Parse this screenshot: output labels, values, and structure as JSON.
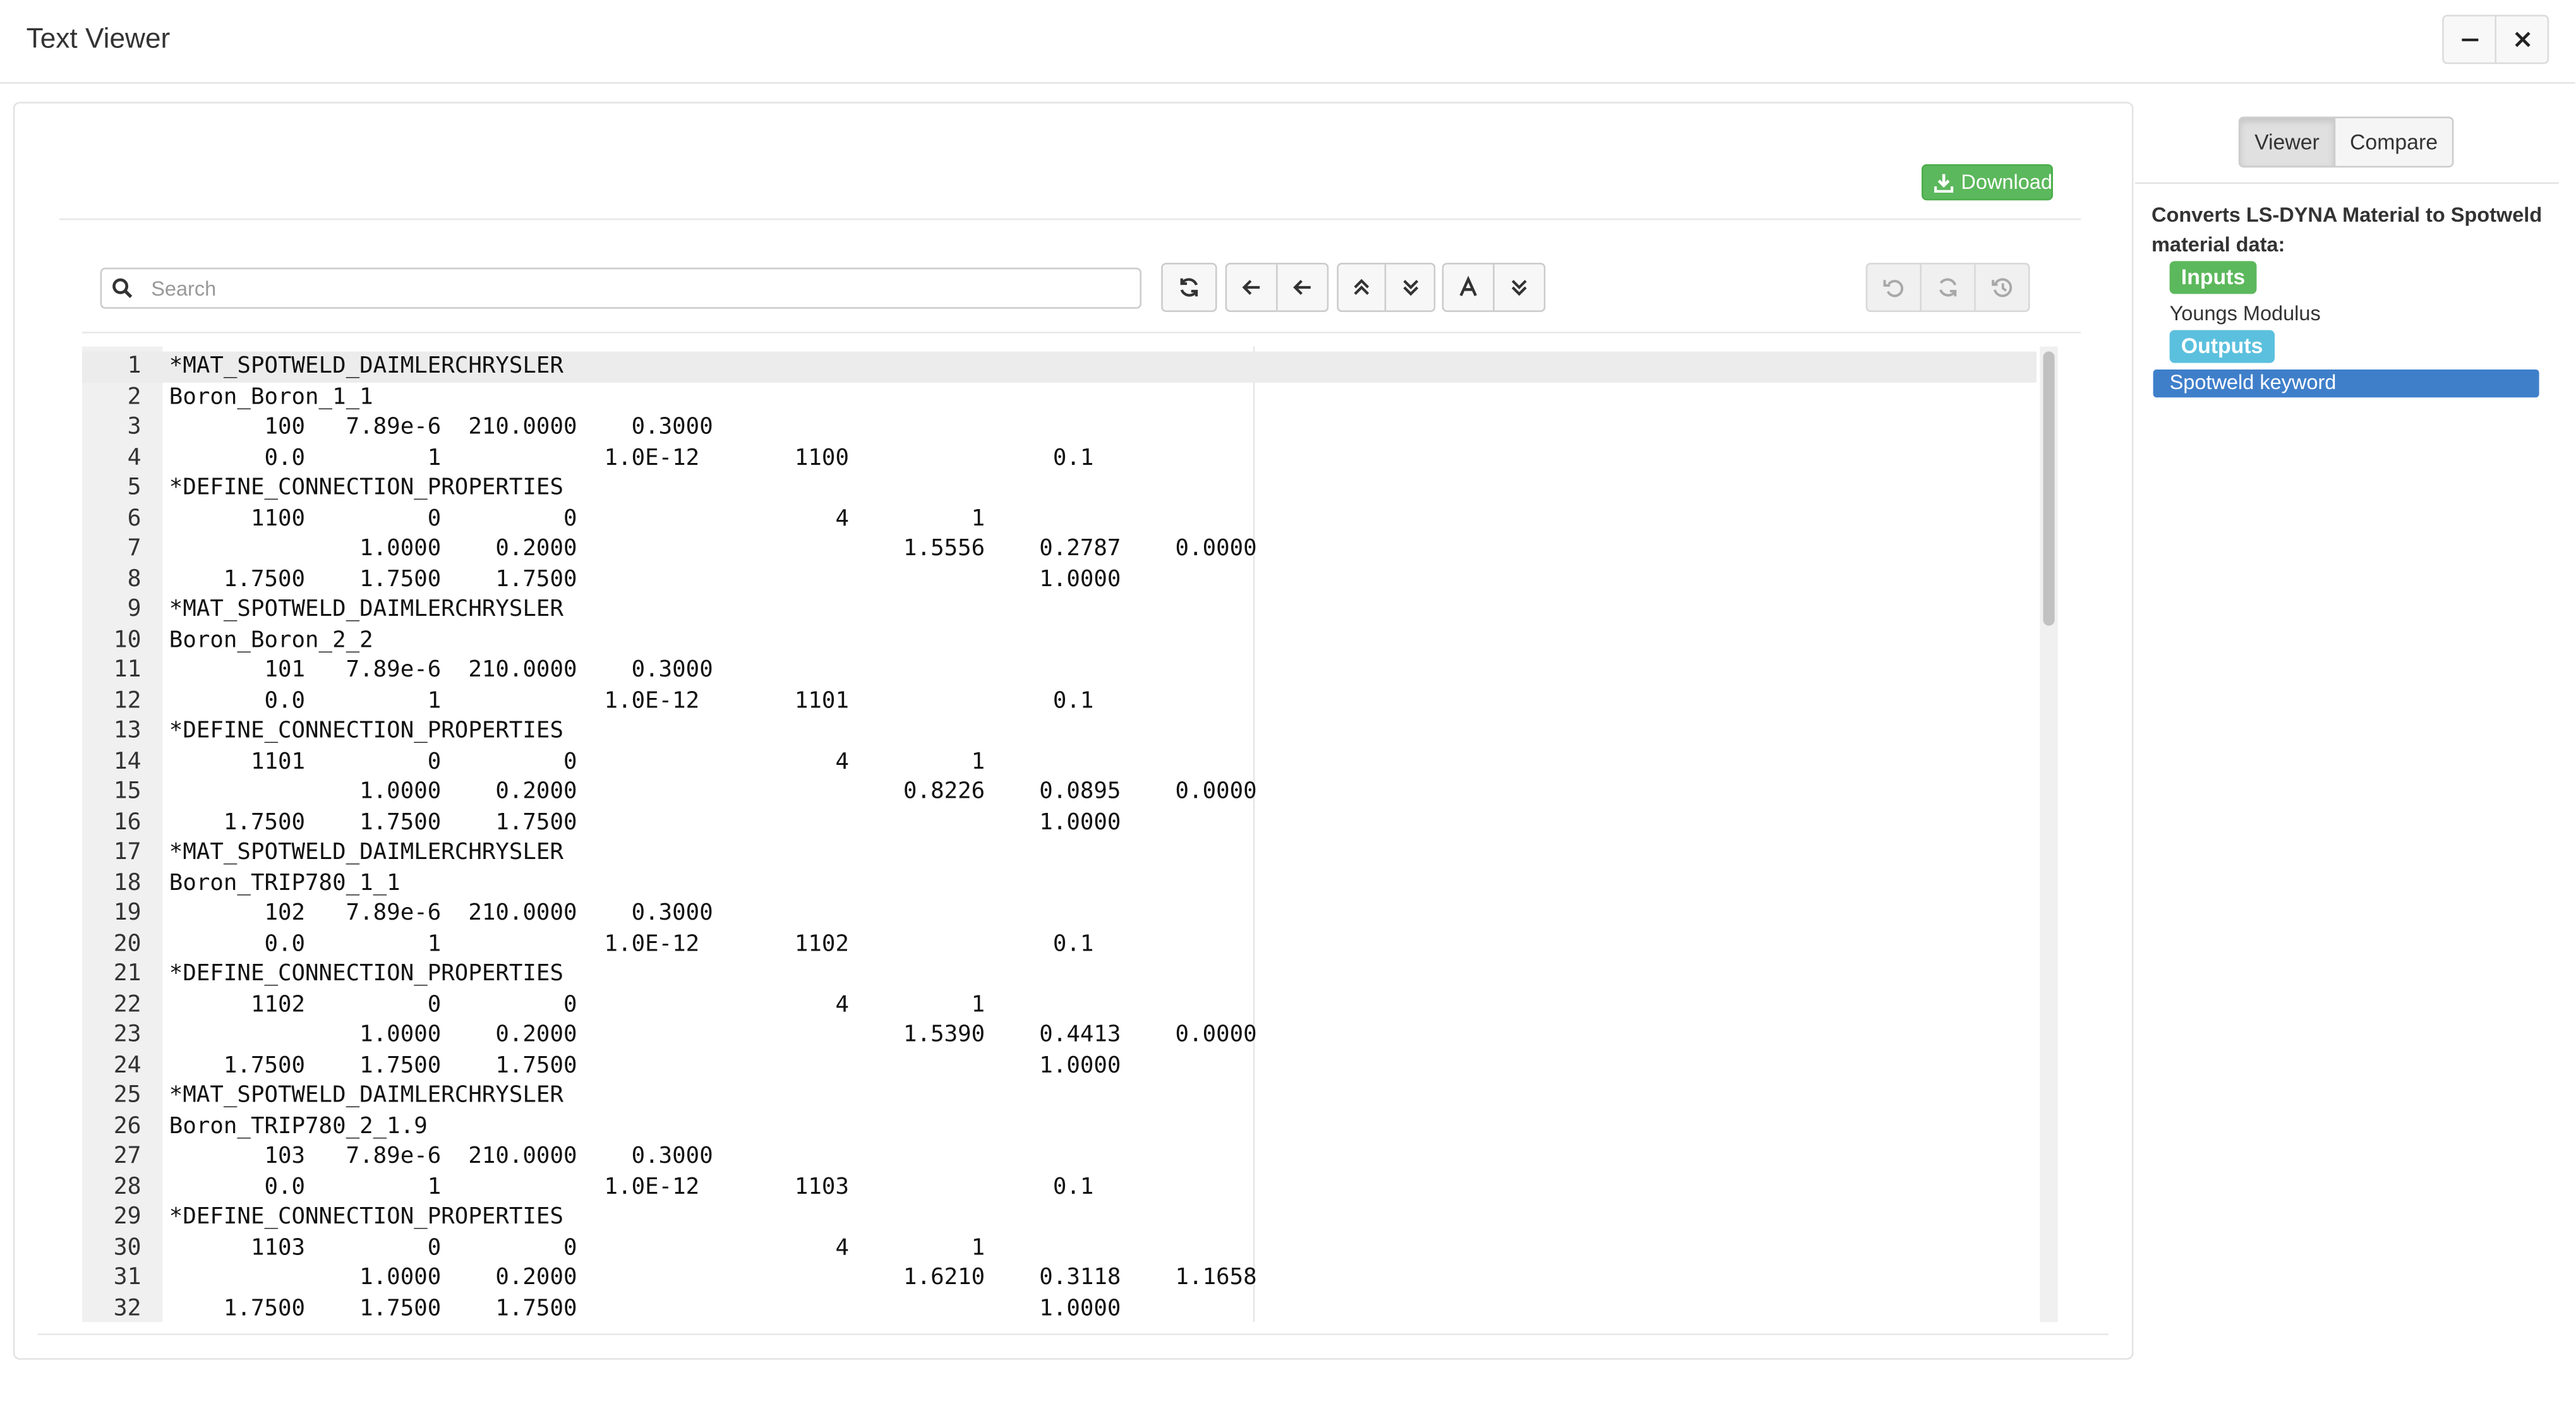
{
  "window": {
    "title": "Text Viewer",
    "minimize_icon": "minus-icon",
    "close_icon": "close-icon"
  },
  "download": {
    "label": "Download",
    "icon": "download-icon",
    "color": "#5cb85c"
  },
  "search": {
    "placeholder": "Search",
    "value": "",
    "icon": "search-icon"
  },
  "toolbar": {
    "icons": [
      "refresh-icon",
      "arrow-left-icon",
      "arrow-left-icon",
      "chevrons-up-icon",
      "chevrons-down-icon",
      "font-icon",
      "chevrons-down-icon",
      "undo-icon",
      "redo-icon",
      "history-icon"
    ]
  },
  "editor": {
    "active_line": 1,
    "lines": [
      "*MAT_SPOTWELD_DAIMLERCHRYSLER",
      "Boron_Boron_1_1",
      "       100   7.89e-6  210.0000    0.3000",
      "       0.0         1            1.0E-12       1100               0.1",
      "*DEFINE_CONNECTION_PROPERTIES",
      "      1100         0         0                   4         1",
      "              1.0000    0.2000                        1.5556    0.2787    0.0000",
      "    1.7500    1.7500    1.7500                                  1.0000",
      "*MAT_SPOTWELD_DAIMLERCHRYSLER",
      "Boron_Boron_2_2",
      "       101   7.89e-6  210.0000    0.3000",
      "       0.0         1            1.0E-12       1101               0.1",
      "*DEFINE_CONNECTION_PROPERTIES",
      "      1101         0         0                   4         1",
      "              1.0000    0.2000                        0.8226    0.0895    0.0000",
      "    1.7500    1.7500    1.7500                                  1.0000",
      "*MAT_SPOTWELD_DAIMLERCHRYSLER",
      "Boron_TRIP780_1_1",
      "       102   7.89e-6  210.0000    0.3000",
      "       0.0         1            1.0E-12       1102               0.1",
      "*DEFINE_CONNECTION_PROPERTIES",
      "      1102         0         0                   4         1",
      "              1.0000    0.2000                        1.5390    0.4413    0.0000",
      "    1.7500    1.7500    1.7500                                  1.0000",
      "*MAT_SPOTWELD_DAIMLERCHRYSLER",
      "Boron_TRIP780_2_1.9",
      "       103   7.89e-6  210.0000    0.3000",
      "       0.0         1            1.0E-12       1103               0.1",
      "*DEFINE_CONNECTION_PROPERTIES",
      "      1103         0         0                   4         1",
      "              1.0000    0.2000                        1.6210    0.3118    1.1658",
      "    1.7500    1.7500    1.7500                                  1.0000"
    ]
  },
  "side": {
    "tabs": [
      {
        "label": "Viewer",
        "active": true
      },
      {
        "label": "Compare",
        "active": false
      }
    ],
    "description": "Converts LS-DYNA Material to Spotweld material data:",
    "inputs_label": "Inputs",
    "inputs": [
      "Youngs Modulus"
    ],
    "outputs_label": "Outputs",
    "outputs": [
      "Spotweld keyword"
    ],
    "colors": {
      "inputs": "#5cb85c",
      "outputs": "#5bc0de",
      "selected": "#3f7fca"
    }
  }
}
